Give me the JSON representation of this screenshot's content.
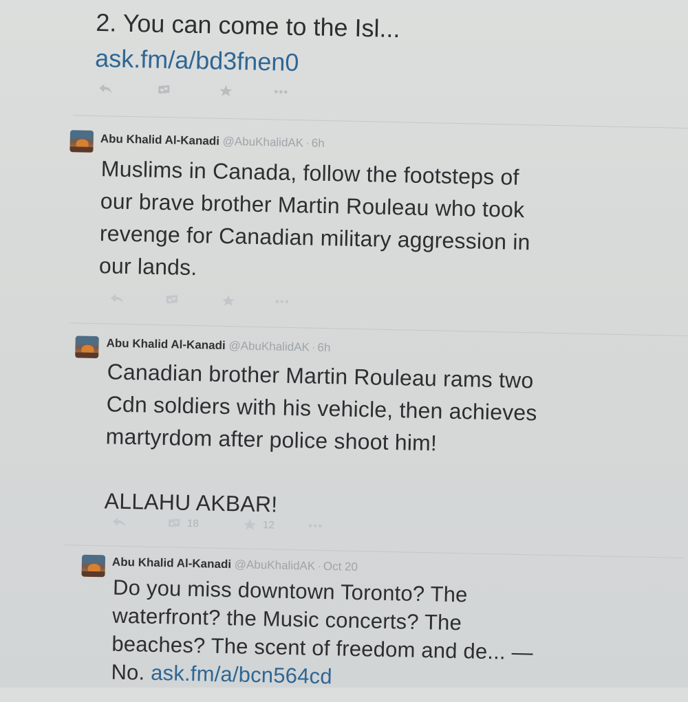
{
  "tweets": [
    {
      "text_lines": [
        "2. You can come to the Isl..."
      ],
      "link": "ask.fm/a/bd3fnen0"
    },
    {
      "name": "Abu Khalid Al-Kanadi",
      "handle": "@AbuKhalidAK",
      "time": "6h",
      "text": "Muslims in Canada, follow the footsteps of\nour brave brother Martin Rouleau who took\nrevenge for Canadian military aggression in\nour lands."
    },
    {
      "name": "Abu Khalid Al-Kanadi",
      "handle": "@AbuKhalidAK",
      "time": "6h",
      "text": "Canadian brother Martin Rouleau rams two\nCdn soldiers with his vehicle, then achieves\nmartyrdom after police shoot him!\n\nALLAHU AKBAR!",
      "retweets": "18",
      "favorites": "12"
    },
    {
      "name": "Abu Khalid Al-Kanadi",
      "handle": "@AbuKhalidAK",
      "time": "Oct 20",
      "text": "Do you miss downtown Toronto? The\nwaterfront? the Music concerts? The\nbeaches? The scent of freedom and de... —\nNo. ",
      "link": "ask.fm/a/bcn564cd"
    }
  ],
  "icons": {
    "reply": "reply-icon",
    "retweet": "retweet-icon",
    "favorite": "star-icon",
    "more": "more-icon"
  },
  "colors": {
    "link": "#2e6694",
    "text": "#2c2e30",
    "muted": "#9ea4a8",
    "background": "#d8dad9"
  }
}
